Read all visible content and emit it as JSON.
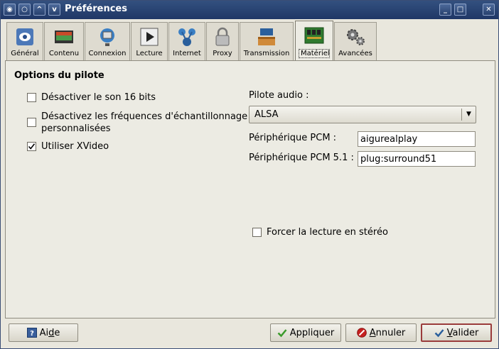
{
  "window": {
    "title": "Préférences",
    "titlebar_buttons": {
      "menu": "◉",
      "sticky": "○",
      "up": "^",
      "down": "v"
    },
    "controls": {
      "minimize": "_",
      "maximize": "□",
      "close": "✕"
    }
  },
  "tabs": [
    {
      "label": "Général",
      "icon": "general-icon"
    },
    {
      "label": "Contenu",
      "icon": "content-icon"
    },
    {
      "label": "Connexion",
      "icon": "network-icon"
    },
    {
      "label": "Lecture",
      "icon": "play-icon"
    },
    {
      "label": "Internet",
      "icon": "internet-icon"
    },
    {
      "label": "Proxy",
      "icon": "lock-icon"
    },
    {
      "label": "Transmission",
      "icon": "transmission-icon"
    },
    {
      "label": "Matériel",
      "icon": "hardware-icon",
      "active": true
    },
    {
      "label": "Avancées",
      "icon": "gears-icon"
    }
  ],
  "panel": {
    "section_title": "Options du pilote",
    "checks": {
      "sound16": {
        "label": "Désactiver le son 16 bits",
        "checked": false
      },
      "custom_rates": {
        "line1": "Désactivez les fréquences d'échantillonnage",
        "line2": "personnalisées",
        "checked": false
      },
      "xvideo": {
        "label": "Utiliser XVideo",
        "checked": true
      },
      "stereo": {
        "label": "Forcer la lecture en stéréo",
        "checked": false
      }
    },
    "audio_driver": {
      "label": "Pilote audio :",
      "value": "ALSA",
      "arrow": "▼"
    },
    "pcm": {
      "label": "Périphérique PCM :",
      "value": "aigurealplay"
    },
    "pcm51": {
      "label": "Périphérique PCM 5.1 :",
      "value": "plug:surround51"
    }
  },
  "buttons": {
    "help": {
      "label_pre": "Ai",
      "label_u": "d",
      "label_post": "e"
    },
    "apply": {
      "label": "Appliquer"
    },
    "cancel": {
      "label_u": "A",
      "label_post": "nnuler"
    },
    "ok": {
      "label_u": "V",
      "label_post": "alider"
    }
  },
  "colors": {
    "titlebar": "#1f3766",
    "accent_check": "#3a9a2a",
    "cancel_red": "#c62020"
  }
}
